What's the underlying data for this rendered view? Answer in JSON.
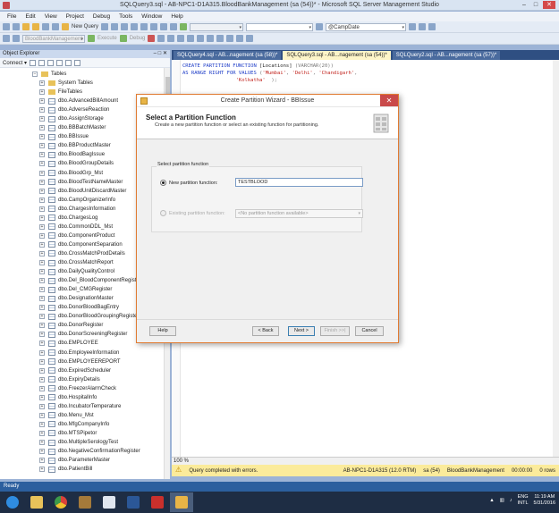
{
  "window": {
    "title": "SQLQuery3.sql - AB-NPC1-D1A315.BloodBankManagement (sa (54))* - Microsoft SQL Server Management Studio",
    "minimize": "–",
    "maximize": "□",
    "close": "✕"
  },
  "menu": {
    "items": [
      "File",
      "Edit",
      "View",
      "Project",
      "Debug",
      "Tools",
      "Window",
      "Help"
    ]
  },
  "toolbar": {
    "new_query": "New Query",
    "database": "BloodBankManagement",
    "execute": "Execute",
    "debug": "Debug",
    "search_combo": "@CampDate"
  },
  "object_explorer": {
    "title": "Object Explorer",
    "pin": "– □ ✕",
    "connect": "Connect ▾",
    "tables_node": "Tables",
    "items": [
      "System Tables",
      "FileTables",
      "dbo.AdvancedBillAmount",
      "dbo.AdverseReaction",
      "dbo.AssignStorage",
      "dbo.BBBatchMaster",
      "dbo.BBIssue",
      "dbo.BBProductMaster",
      "dbo.BloodBagIssue",
      "dbo.BloodGroupDetails",
      "dbo.BloodGrp_Mst",
      "dbo.BloodTestNameMaster",
      "dbo.BloodUnitDiscardMaster",
      "dbo.CampOrganizerInfo",
      "dbo.ChargesInformation",
      "dbo.ChargesLog",
      "dbo.CommonDDL_Mst",
      "dbo.ComponentProduct",
      "dbo.ComponentSeparation",
      "dbo.CrossMatchProdDetails",
      "dbo.CrossMatchReport",
      "dbo.DailyQualityControl",
      "dbo.Del_BloodComponentRegister",
      "dbo.Del_CMGRegister",
      "dbo.DesignationMaster",
      "dbo.DonorBloodBagEntry",
      "dbo.DonorBloodGroupingRegister",
      "dbo.DonorRegister",
      "dbo.DonorScreeningRegister",
      "dbo.EMPLOYEE",
      "dbo.EmployeeInformation",
      "dbo.EMPLOYEEREPORT",
      "dbo.ExpiredScheduler",
      "dbo.ExpiryDetails",
      "dbo.FreezerAlarmCheck",
      "dbo.HospitalInfo",
      "dbo.IncubatorTemperature",
      "dbo.Menu_Mst",
      "dbo.MfgCompanyInfo",
      "dbo.MTSPipetor",
      "dbo.MultipleSerologyTest",
      "dbo.NegativeConfirmationRegister",
      "dbo.ParameterMaster",
      "dbo.PatientBill"
    ]
  },
  "tabs": [
    {
      "label": "SQLQuery4.sql - AB...nagement (sa (58))*"
    },
    {
      "label": "SQLQuery3.sql - AB...nagement (sa (54))*"
    },
    {
      "label": "SQLQuery2.sql - AB...nagement (sa (57))*"
    }
  ],
  "code": {
    "line1_kw": "CREATE PARTITION FUNCTION",
    "line1_name": " [Locations] ",
    "line1_type": "(VARCHAR(20))",
    "line2_kw": "AS RANGE RIGHT FOR VALUES",
    "line2_open": " (",
    "v1": "'Mumbai'",
    "v2": "'Delhi'",
    "v3": "'Chandigarh'",
    "v4": "'Kolkatha'",
    "line3_close": "  );"
  },
  "zoom": "100 %",
  "query_status": {
    "message": "Query completed with errors.",
    "server": "AB-NPC1-D1A315 (12.0 RTM)",
    "user": "sa (54)",
    "database": "BloodBankManagement",
    "time": "00:00:00",
    "rows": "0 rows"
  },
  "status_bar": {
    "text": "Ready"
  },
  "taskbar": {
    "lang_line1": "ENG",
    "lang_line2": "INTL",
    "time": "11:19 AM",
    "date": "5/31/2016"
  },
  "dialog": {
    "title": "Create Partition Wizard - BBIssue",
    "close": "✕",
    "heading": "Select a Partition Function",
    "subheading": "Create a new partition function or select an existing function for partitioning.",
    "group_label": "Select partition function",
    "new_label": "New partition function:",
    "new_value": "TESTBLOOD",
    "existing_label": "Existing partition function:",
    "existing_value": "<No partition function available>",
    "buttons": {
      "help": "Help",
      "back": "< Back",
      "next": "Next >",
      "finish": "Finish >>|",
      "cancel": "Cancel"
    }
  }
}
